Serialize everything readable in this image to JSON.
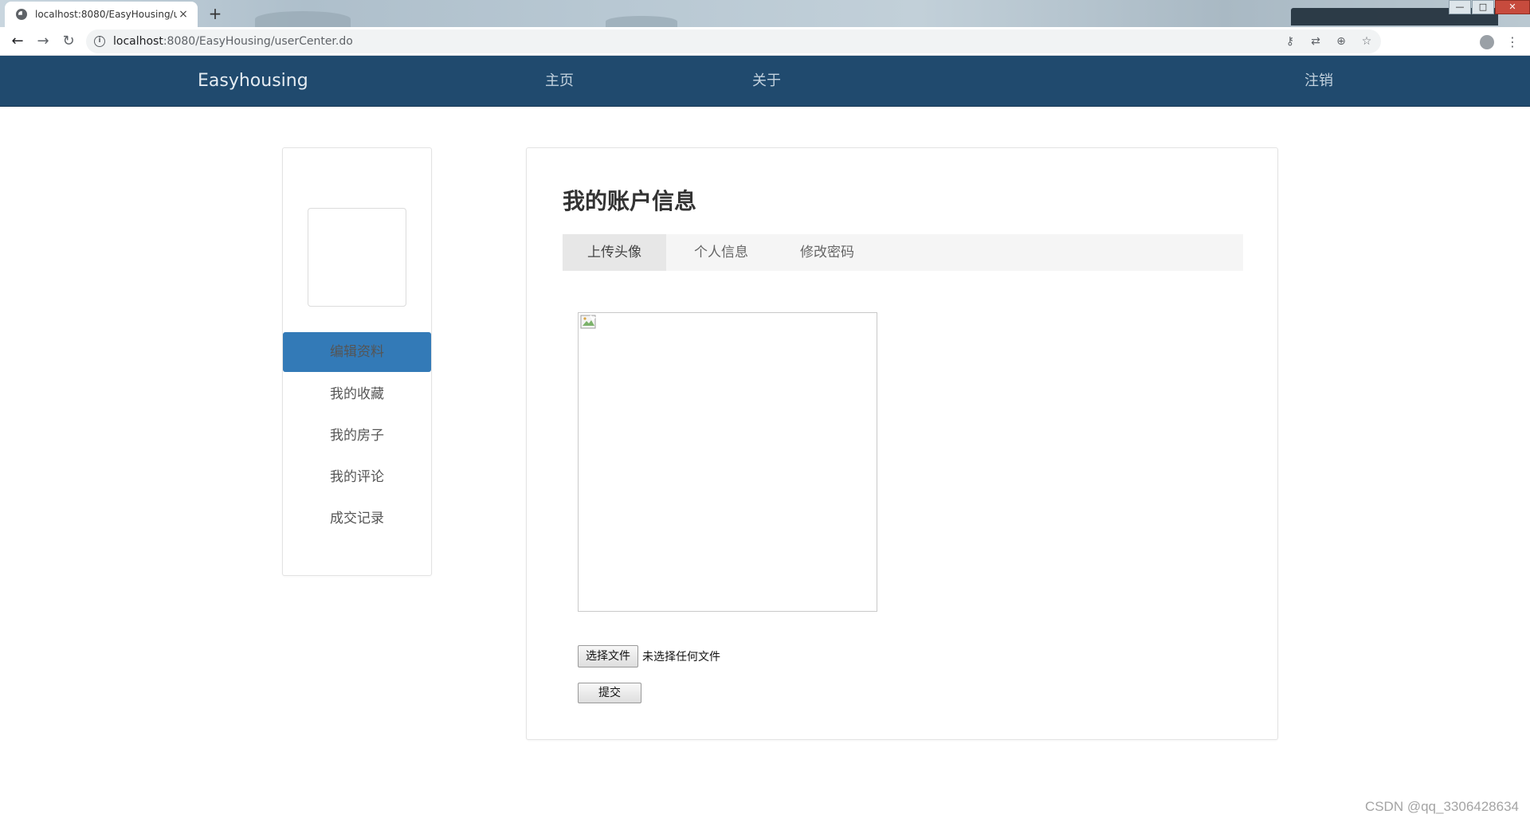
{
  "browser": {
    "tab_title": "localhost:8080/EasyHousing/u",
    "tab_close": "×",
    "new_tab": "+",
    "url_host": "localhost",
    "url_path": ":8080/EasyHousing/userCenter.do",
    "window_controls": {
      "minimize": "—",
      "maximize": "□",
      "close": "✕"
    }
  },
  "icons": {
    "back": "←",
    "forward": "→",
    "reload": "↻",
    "info": "i",
    "key": "⚷",
    "translate": "⇄",
    "zoom": "⊕",
    "star": "☆",
    "menu": "⋮"
  },
  "navbar": {
    "brand": "Easyhousing",
    "links": [
      "主页",
      "关于"
    ],
    "logout": "注销"
  },
  "sidebar": {
    "items": [
      "编辑资料",
      "我的收藏",
      "我的房子",
      "我的评论",
      "成交记录"
    ],
    "active_index": 0
  },
  "main": {
    "title": "我的账户信息",
    "tabs": [
      "上传头像",
      "个人信息",
      "修改密码"
    ],
    "active_tab": 0,
    "choose_file_label": "选择文件",
    "no_file_text": "未选择任何文件",
    "submit_label": "提交"
  },
  "watermark": "CSDN @qq_3306428634",
  "colors": {
    "navbar_bg": "#204a6e",
    "sidebar_active_bg": "#337ab7",
    "tabs_bg": "#f5f5f5",
    "tab_active_bg": "#e7e7e7"
  }
}
